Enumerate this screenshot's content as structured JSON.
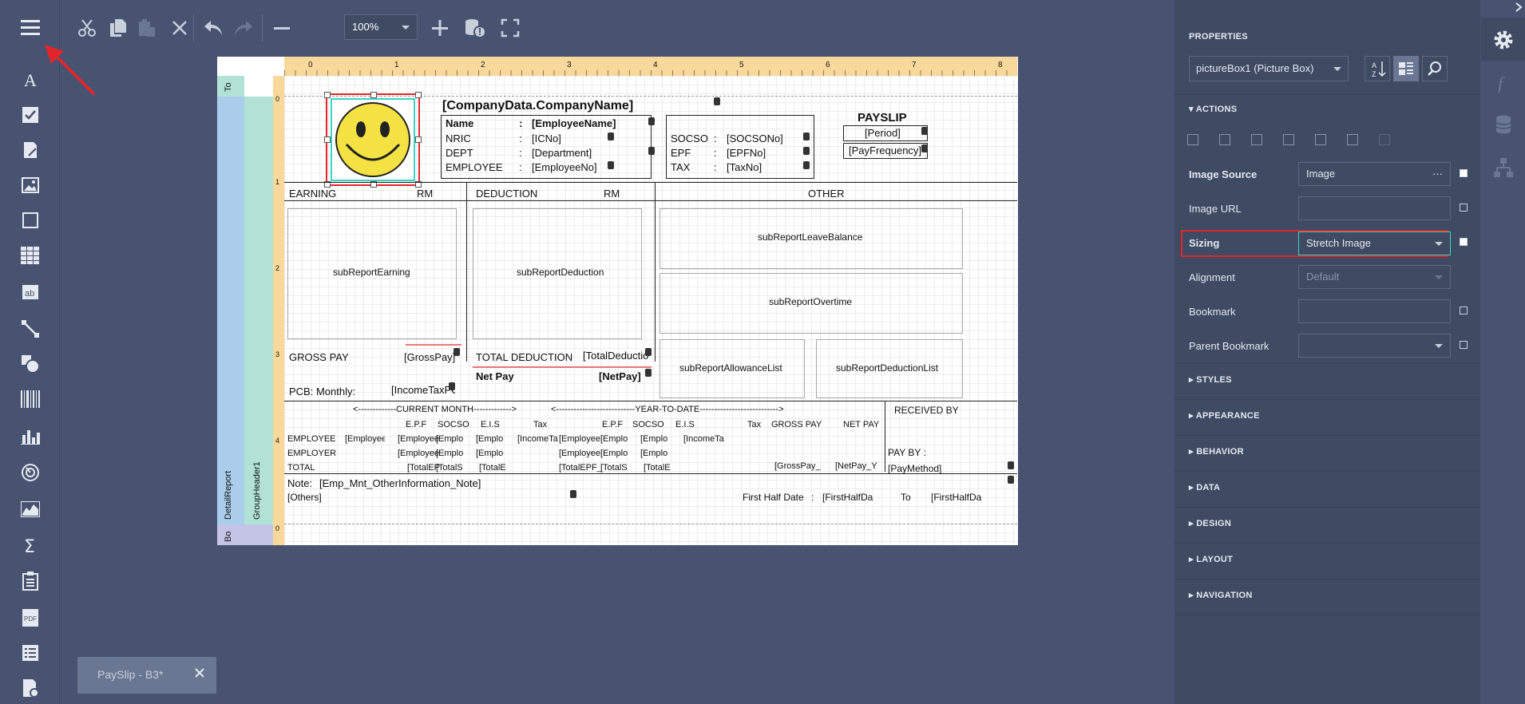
{
  "toolbar": {
    "zoom_value": "100%"
  },
  "document_tab": {
    "label": "PaySlip - B3*"
  },
  "bands": {
    "detail_report": "DetailReport",
    "group_header": "GroupHeader1",
    "top": "To",
    "bottom": "Bo"
  },
  "ruler": {
    "h_ticks": [
      "0",
      "1",
      "2",
      "3",
      "4",
      "5",
      "6",
      "7",
      "8"
    ],
    "v_ticks": [
      "0",
      "1",
      "2",
      "3",
      "4",
      "0"
    ]
  },
  "report": {
    "company_name": "[CompanyData.CompanyName]",
    "payslip_title": "PAYSLIP",
    "period": "[Period]",
    "pay_frequency": "[PayFrequency]",
    "name_label": "Name",
    "name_value": "[EmployeeName]",
    "nric_label": "NRIC",
    "nric_value": "[ICNo]",
    "dept_label": "DEPT",
    "dept_value": "[Department]",
    "employee_label": "EMPLOYEE",
    "employee_value": "[EmployeeNo]",
    "socso_label": "SOCSO",
    "socso_value": "[SOCSONo]",
    "epf_label": "EPF",
    "epf_value": "[EPFNo]",
    "tax_label": "TAX",
    "tax_value": "[TaxNo]",
    "colon": ":",
    "earning": "EARNING",
    "rm": "RM",
    "deduction": "DEDUCTION",
    "other": "OTHER",
    "sub_earning": "subReportEarning",
    "sub_deduction": "subReportDeduction",
    "sub_leave": "subReportLeaveBalance",
    "sub_overtime": "subReportOvertime",
    "sub_allowance": "subReportAllowanceList",
    "sub_deduction_list": "subReportDeductionList",
    "gross_pay": "GROSS PAY",
    "gross_pay_value": "[GrossPay]",
    "total_deduction": "TOTAL DEDUCTION",
    "total_deduction_value": "[TotalDeductio",
    "net_pay": "Net Pay",
    "net_pay_value": "[NetPay]",
    "pcb_label": "PCB: Monthly:",
    "pcb_value": "[IncomeTaxPC",
    "current_month": "<-------------CURRENT MONTH------------->",
    "year_to_date": "<---------------------------YEAR-TO-DATE--------------------------->",
    "received_by": "RECEIVED BY",
    "col_epf": "E.P.F",
    "col_socso": "SOCSO",
    "col_eis": "E.I.S",
    "col_tax": "Tax",
    "col_gross": "GROSS PAY",
    "col_net": "NET PAY",
    "row_employee": "EMPLOYEE",
    "row_employer": "EMPLOYER",
    "row_total": "TOTAL",
    "cell_employee": "[Employee",
    "cell_empl": "[Emplo",
    "cell_income": "[IncomeTa",
    "cell_total_epf": "[TotalEP",
    "cell_total_s": "[TotalS",
    "cell_total_e": "[TotalE",
    "cell_total_epf_y": "[TotalEPF_",
    "cell_gross_y": "[GrossPay_",
    "cell_net_y": "[NetPay_Y",
    "pay_by": "PAY BY :",
    "pay_method": "[PayMethod]",
    "note_label": "Note:",
    "note_value": "[Emp_Mnt_OtherInformation_Note]",
    "others": "[Others]",
    "first_half": "First Half Date",
    "first_half_value": "[FirstHalfDa",
    "to": "To",
    "first_half_value2": "[FirstHalfDa"
  },
  "properties": {
    "title": "PROPERTIES",
    "component": "pictureBox1 (Picture Box)",
    "sections": {
      "actions": "ACTIONS",
      "styles": "STYLES",
      "appearance": "APPEARANCE",
      "behavior": "BEHAVIOR",
      "data": "DATA",
      "design": "DESIGN",
      "layout": "LAYOUT",
      "navigation": "NAVIGATION"
    },
    "image_source_label": "Image Source",
    "image_source_value": "Image",
    "image_url_label": "Image URL",
    "image_url_value": "",
    "sizing_label": "Sizing",
    "sizing_value": "Stretch Image",
    "alignment_label": "Alignment",
    "alignment_value": "Default",
    "bookmark_label": "Bookmark",
    "bookmark_value": "",
    "parent_bookmark_label": "Parent Bookmark",
    "parent_bookmark_value": ""
  },
  "colors": {
    "background": "#475370",
    "panel": "#3f4a63",
    "highlight_red": "#e0262b",
    "ruler": "#f9d99b",
    "band_blue": "#a9cdea",
    "band_teal": "#b2e2d6",
    "smiley_yellow": "#f4e242"
  }
}
